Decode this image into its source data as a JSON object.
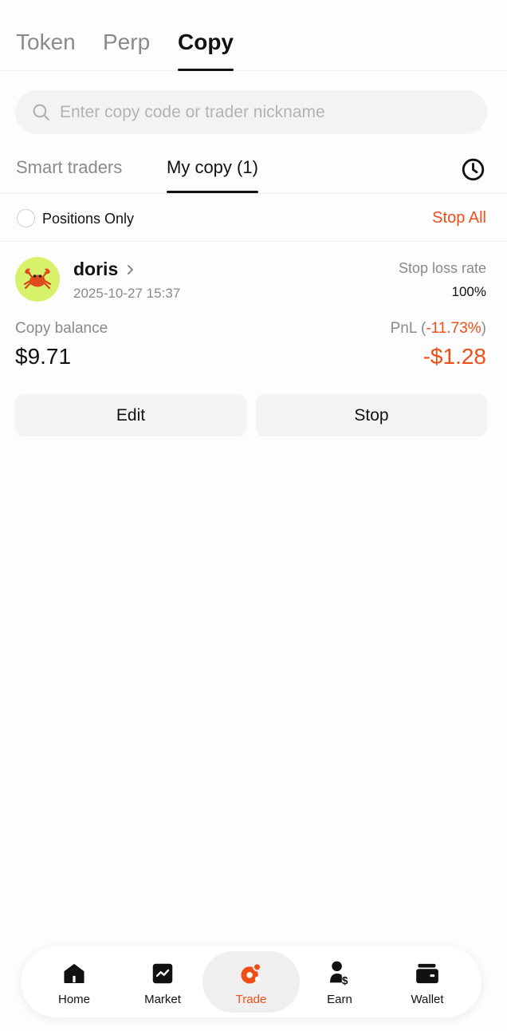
{
  "top_tabs": [
    {
      "label": "Token"
    },
    {
      "label": "Perp"
    },
    {
      "label": "Copy"
    }
  ],
  "search": {
    "placeholder": "Enter copy code or trader nickname",
    "value": ""
  },
  "sub_tabs": [
    {
      "label": "Smart traders"
    },
    {
      "label": "My copy (1)"
    }
  ],
  "filter": {
    "positions_only_label": "Positions Only",
    "stop_all_label": "Stop All"
  },
  "copy_card": {
    "trader_name": "doris",
    "date": "2025-10-27 15:37",
    "stop_loss_label": "Stop loss rate",
    "stop_loss_value": "100%",
    "copy_balance_label": "Copy balance",
    "copy_balance_value": "$9.71",
    "pnl_label_prefix": "PnL (",
    "pnl_percent": "-11.73%",
    "pnl_label_suffix": ")",
    "pnl_value": "-$1.28",
    "edit_label": "Edit",
    "stop_label": "Stop"
  },
  "bottom_nav": [
    {
      "label": "Home",
      "icon": "home-icon"
    },
    {
      "label": "Market",
      "icon": "market-icon"
    },
    {
      "label": "Trade",
      "icon": "trade-icon"
    },
    {
      "label": "Earn",
      "icon": "earn-icon"
    },
    {
      "label": "Wallet",
      "icon": "wallet-icon"
    }
  ],
  "colors": {
    "accent": "#f04e15",
    "avatar_bg": "#d7f26a",
    "muted": "#8a8a8a"
  }
}
